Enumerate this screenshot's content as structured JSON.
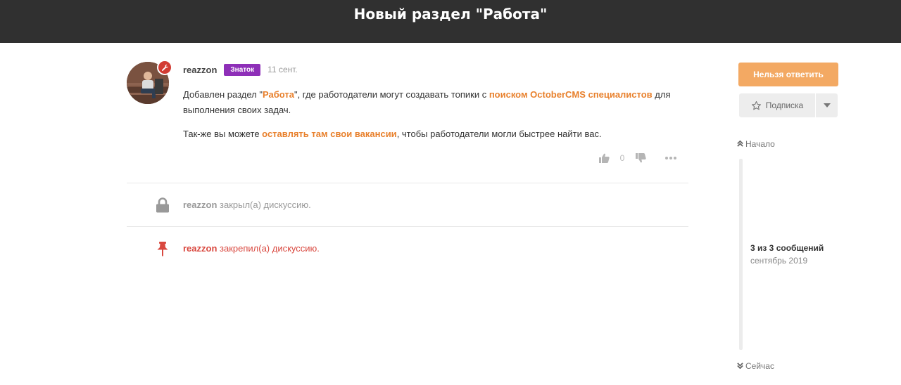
{
  "discussion": {
    "title": "Новый раздел \"Работа\""
  },
  "post": {
    "user": "reazzon",
    "group_badge": "Знаток",
    "time": "11 сент.",
    "paragraph1": {
      "t1": "Добавлен раздел \"",
      "link1": "Работа",
      "t2": "\", где работодатели могут создавать топики с ",
      "link2": "поиском OctoberCMS специалистов",
      "t3": " для выполнения своих задач."
    },
    "paragraph2": {
      "t1": "Так-же вы можете ",
      "link1": "оставлять там свои вакансии",
      "t2": ", чтобы работодатели могли быстрее найти вас."
    },
    "votes": "0"
  },
  "events": [
    {
      "user": "reazzon",
      "action": " закрыл(а) дискуссию.",
      "icon": "lock-icon",
      "color": "#999999"
    },
    {
      "user": "reazzon",
      "action": " закрепил(а) дискуссию.",
      "icon": "pin-icon",
      "color": "#d9483f"
    }
  ],
  "sidebar": {
    "reply_label": "Нельзя ответить",
    "subscribe_label": "Подписка",
    "scrub_top": "Начало",
    "scrub_count": "3 из 3 сообщений",
    "scrub_date": "сентябрь 2019",
    "scrub_bottom": "Сейчас"
  },
  "colors": {
    "accent": "#e8802c",
    "header_bg": "#303030",
    "badge": "#8e2fb8",
    "reply_button": "#f3a963",
    "event_pinned": "#d9483f"
  }
}
